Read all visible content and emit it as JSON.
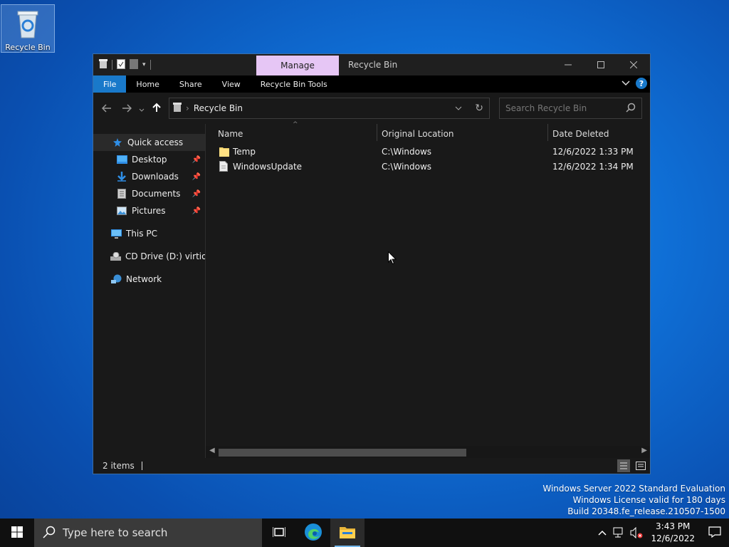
{
  "desktop": {
    "icons": [
      {
        "label": "Recycle Bin",
        "icon": "recycle-bin-icon"
      }
    ]
  },
  "window": {
    "context_tab": "Manage",
    "title": "Recycle Bin",
    "ribbon_tabs": [
      "File",
      "Home",
      "Share",
      "View",
      "Recycle Bin Tools"
    ],
    "address": {
      "crumb": "Recycle Bin"
    },
    "search_placeholder": "Search Recycle Bin",
    "sidebar": {
      "items": [
        {
          "label": "Quick access",
          "icon": "star-icon",
          "level": 0,
          "selected": true,
          "pinned": false
        },
        {
          "label": "Desktop",
          "icon": "desktop-folder-icon",
          "level": 1,
          "pinned": true
        },
        {
          "label": "Downloads",
          "icon": "download-arrow-icon",
          "level": 1,
          "pinned": true
        },
        {
          "label": "Documents",
          "icon": "document-icon",
          "level": 1,
          "pinned": true
        },
        {
          "label": "Pictures",
          "icon": "picture-icon",
          "level": 1,
          "pinned": true
        },
        {
          "label": "This PC",
          "icon": "computer-icon",
          "level": 0,
          "pinned": false
        },
        {
          "label": "CD Drive (D:) virtio-w",
          "icon": "cd-drive-icon",
          "level": 0,
          "pinned": false
        },
        {
          "label": "Network",
          "icon": "network-icon",
          "level": 0,
          "pinned": false
        }
      ]
    },
    "columns": [
      "Name",
      "Original Location",
      "Date Deleted"
    ],
    "rows": [
      {
        "name": "Temp",
        "icon": "folder-icon",
        "location": "C:\\Windows",
        "date": "12/6/2022 1:33 PM"
      },
      {
        "name": "WindowsUpdate",
        "icon": "file-icon",
        "location": "C:\\Windows",
        "date": "12/6/2022 1:34 PM"
      }
    ],
    "status": "2 items"
  },
  "watermark": {
    "line1": "Windows Server 2022 Standard Evaluation",
    "line2": "Windows License valid for 180 days",
    "line3": "Build 20348.fe_release.210507-1500"
  },
  "taskbar": {
    "search_placeholder": "Type here to search",
    "time": "3:43 PM",
    "date": "12/6/2022"
  },
  "colors": {
    "accent": "#1979ca",
    "manage_tab": "#e6c6f5",
    "window_bg": "#191919"
  }
}
